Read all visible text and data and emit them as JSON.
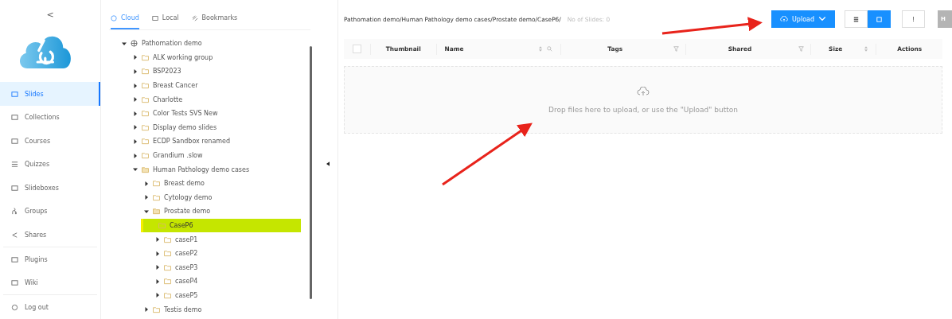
{
  "sidebar": {
    "collapse": "<",
    "items": [
      {
        "label": "Slides",
        "selected": true
      },
      {
        "label": "Collections",
        "selected": false
      },
      {
        "label": "Courses",
        "selected": false
      },
      {
        "label": "Quizzes",
        "selected": false
      },
      {
        "label": "Slideboxes",
        "selected": false
      },
      {
        "label": "Groups",
        "selected": false
      },
      {
        "label": "Shares",
        "selected": false
      },
      {
        "label": "Plugins",
        "selected": false
      },
      {
        "label": "Wiki",
        "selected": false
      },
      {
        "label": "Log out",
        "selected": false
      }
    ]
  },
  "tabs": [
    {
      "label": "Cloud",
      "selected": true
    },
    {
      "label": "Local",
      "selected": false
    },
    {
      "label": "Bookmarks",
      "selected": false
    }
  ],
  "tree": [
    {
      "label": "Pathomation demo",
      "kind": "server",
      "expanded": true,
      "selected": false,
      "children": [
        {
          "label": "ALK working group",
          "kind": "folder",
          "expanded": false,
          "selected": false
        },
        {
          "label": "BSP2023",
          "kind": "folder",
          "expanded": false,
          "selected": false
        },
        {
          "label": "Breast Cancer",
          "kind": "folder",
          "expanded": false,
          "selected": false
        },
        {
          "label": "Charlotte",
          "kind": "folder",
          "expanded": false,
          "selected": false
        },
        {
          "label": "Color Tests SVS New",
          "kind": "folder",
          "expanded": false,
          "selected": false
        },
        {
          "label": "Display demo slides",
          "kind": "folder",
          "expanded": false,
          "selected": false
        },
        {
          "label": "ECDP Sandbox renamed",
          "kind": "folder",
          "expanded": false,
          "selected": false
        },
        {
          "label": "Grandium .slow",
          "kind": "folder",
          "expanded": false,
          "selected": false
        },
        {
          "label": "Human Pathology demo cases",
          "kind": "folder",
          "expanded": true,
          "selected": false,
          "children": [
            {
              "label": "Breast demo",
              "kind": "folder",
              "expanded": false,
              "selected": false
            },
            {
              "label": "Cytology demo",
              "kind": "folder",
              "expanded": false,
              "selected": false
            },
            {
              "label": "Prostate demo",
              "kind": "folder",
              "expanded": true,
              "selected": false,
              "children": [
                {
                  "label": "CaseP6",
                  "kind": "leaf",
                  "selected": true
                },
                {
                  "label": "caseP1",
                  "kind": "folder",
                  "expanded": false,
                  "selected": false
                },
                {
                  "label": "caseP2",
                  "kind": "folder",
                  "expanded": false,
                  "selected": false
                },
                {
                  "label": "caseP3",
                  "kind": "folder",
                  "expanded": false,
                  "selected": false
                },
                {
                  "label": "caseP4",
                  "kind": "folder",
                  "expanded": false,
                  "selected": false
                },
                {
                  "label": "caseP5",
                  "kind": "folder",
                  "expanded": false,
                  "selected": false
                }
              ]
            },
            {
              "label": "Testis demo",
              "kind": "folder",
              "expanded": false,
              "selected": false
            }
          ]
        }
      ]
    }
  ],
  "main": {
    "path": "Pathomation demo/Human Pathology demo cases/Prostate demo/CaseP6/",
    "slide_count": "No of Slides: 0",
    "upload_button": "Upload",
    "views": [
      {
        "kind": "list",
        "selected": false
      },
      {
        "kind": "grid",
        "selected": true
      }
    ],
    "info_button": "!",
    "avatar": "H",
    "columns": [
      {
        "kind": "check",
        "checked": false
      },
      {
        "label": "Thumbnail",
        "kind": "plain"
      },
      {
        "label": "Name",
        "kind": "sort-search"
      },
      {
        "label": "Tags",
        "kind": "filter"
      },
      {
        "label": "Shared",
        "kind": "filter"
      },
      {
        "label": "Size",
        "kind": "sort"
      },
      {
        "label": "Actions",
        "kind": "plain"
      }
    ],
    "dropzone": "Drop files here to upload, or use the \"Upload\" button"
  }
}
